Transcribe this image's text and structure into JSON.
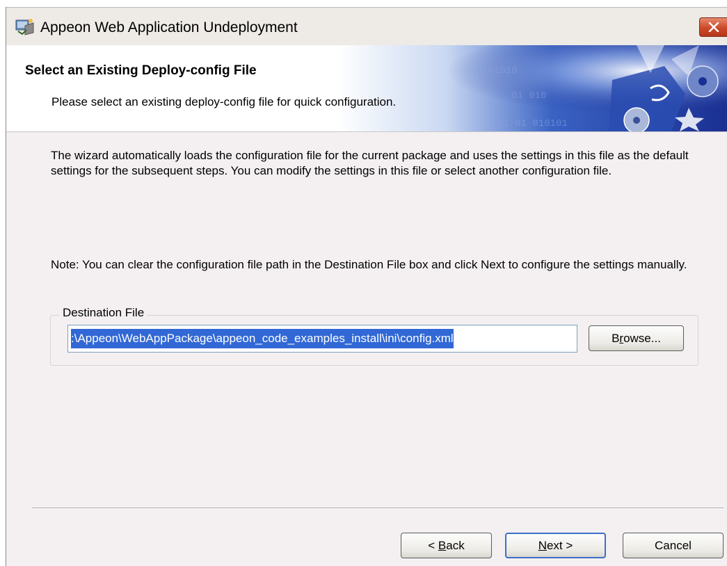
{
  "window": {
    "title": "Appeon Web Application Undeployment"
  },
  "header": {
    "title": "Select an Existing Deploy-config File",
    "subtitle": "Please select an existing deploy-config file for quick configuration."
  },
  "main": {
    "description": "The wizard automatically loads the configuration file for the current package and uses the settings in this file as the default settings for the subsequent steps. You can modify the settings in this file or select another configuration file.",
    "note": "Note: You can clear the configuration file path in the Destination File box and click Next to configure the settings manually."
  },
  "destination": {
    "group_label": "Destination File",
    "value": ":\\Appeon\\WebAppPackage\\appeon_code_examples_install\\ini\\config.xml",
    "browse": {
      "pre": "B",
      "key": "r",
      "post": "owse..."
    }
  },
  "footer": {
    "back": {
      "pre": "< ",
      "key": "B",
      "post": "ack"
    },
    "next": {
      "pre": "",
      "key": "N",
      "post": "ext >"
    },
    "cancel": "Cancel"
  },
  "colors": {
    "selection": "#3168d5",
    "header_blue": "#1e3fa8",
    "close_red": "#cb4a28"
  },
  "icons": [
    "app-icon",
    "close-icon",
    "header-banner"
  ]
}
